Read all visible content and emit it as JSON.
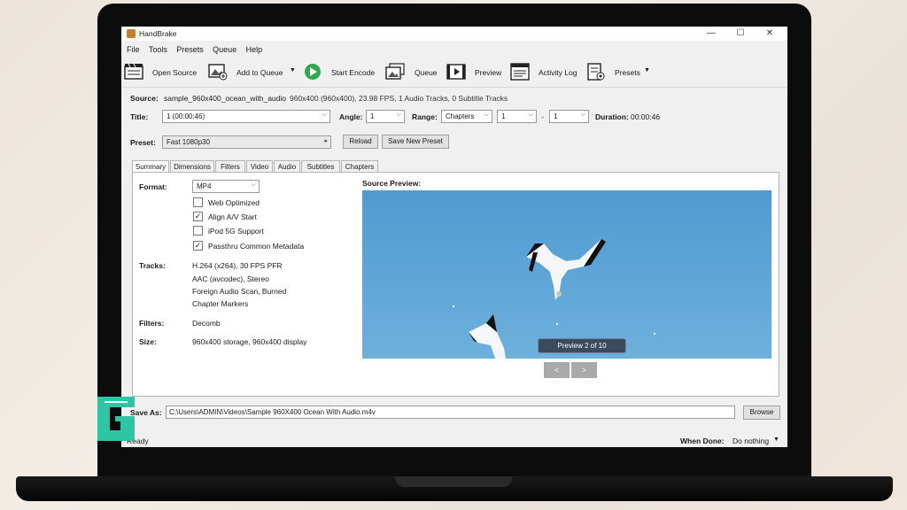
{
  "app": {
    "title": "HandBrake"
  },
  "window_controls": {
    "minimize": "—",
    "maximize": "☐",
    "close": "✕"
  },
  "menu": [
    "File",
    "Tools",
    "Presets",
    "Queue",
    "Help"
  ],
  "toolbar": {
    "open_source": "Open Source",
    "add_to_queue": "Add to Queue",
    "start_encode": "Start Encode",
    "queue": "Queue",
    "preview": "Preview",
    "activity_log": "Activity Log",
    "presets": "Presets"
  },
  "source": {
    "label": "Source:",
    "name": "sample_960x400_ocean_with_audio",
    "details": "960x400 (960x400), 23.98 FPS, 1 Audio Tracks, 0 Subtitle Tracks"
  },
  "title_row": {
    "title_label": "Title:",
    "title_value": "1 (00:00:46)",
    "angle_label": "Angle:",
    "angle_value": "1",
    "range_label": "Range:",
    "range_mode": "Chapters",
    "range_start": "1",
    "range_dash": "-",
    "range_end": "1",
    "duration_label": "Duration:",
    "duration_value": "00:00:46"
  },
  "preset_row": {
    "label": "Preset:",
    "value": "Fast 1080p30",
    "reload": "Reload",
    "save_new": "Save New Preset"
  },
  "tabs": [
    "Summary",
    "Dimensions",
    "Filters",
    "Video",
    "Audio",
    "Subtitles",
    "Chapters"
  ],
  "summary": {
    "format_label": "Format:",
    "format_value": "MP4",
    "options": [
      {
        "label": "Web Optimized",
        "checked": false
      },
      {
        "label": "Align A/V Start",
        "checked": true
      },
      {
        "label": "iPod 5G Support",
        "checked": false
      },
      {
        "label": "Passthru Common Metadata",
        "checked": true
      }
    ],
    "check_mark": "✓",
    "tracks_label": "Tracks:",
    "tracks": [
      "H.264 (x264), 30 FPS PFR",
      "AAC (avcodec), Stereo",
      "Foreign Audio Scan, Burned",
      "Chapter Markers"
    ],
    "filters_label": "Filters:",
    "filters_value": "Decomb",
    "size_label": "Size:",
    "size_value": "960x400 storage, 960x400 display",
    "preview_label": "Source Preview:",
    "preview_badge": "Preview 2 of 10",
    "prev": "<",
    "next": ">"
  },
  "save_as": {
    "label": "Save As:",
    "path": "C:\\Users\\ADMIN\\Videos\\Sample 960X400 Ocean With Audio.m4v",
    "browse": "Browse"
  },
  "status": {
    "ready": "Ready",
    "when_done_label": "When Done:",
    "when_done_value": "Do nothing"
  },
  "colors": {
    "preview_sky": "#5ea6d6",
    "play_green": "#2fa84f",
    "badge_bg": "#3b4a5c"
  }
}
